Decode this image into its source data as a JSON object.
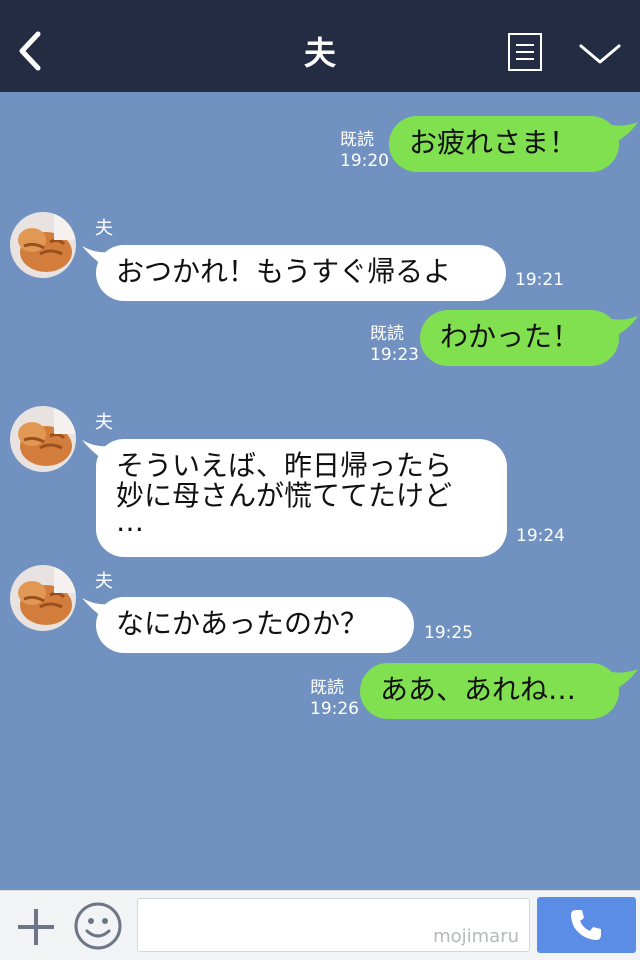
{
  "header": {
    "title": "夫"
  },
  "messages": [
    {
      "from": "me",
      "text": "お疲れさま！",
      "read": "既読",
      "time": "19:20"
    },
    {
      "from": "husband",
      "sender": "夫",
      "text": "おつかれ！もうすぐ帰るよ",
      "time": "19:21"
    },
    {
      "from": "me",
      "text": "わかった！",
      "read": "既読",
      "time": "19:23"
    },
    {
      "from": "husband",
      "sender": "夫",
      "lines": [
        "そういえば、昨日帰ったら",
        "妙に母さんが慌ててたけど",
        "…"
      ],
      "time": "19:24"
    },
    {
      "from": "husband",
      "sender": "夫",
      "text": "なにかあったのか？",
      "time": "19:25"
    },
    {
      "from": "me",
      "text": "ああ、あれね…",
      "read": "既読",
      "time": "19:26"
    }
  ],
  "footer": {
    "watermark": "mojimaru"
  },
  "icons": [
    "back-icon",
    "menu-icon",
    "chevron-down-icon",
    "plus-icon",
    "smiley-icon",
    "phone-icon"
  ],
  "colors": {
    "header": "#232c43",
    "background": "#7192c1",
    "sent_bubble": "#80e050",
    "received_bubble": "#ffffff",
    "call_button": "#5b8ce6"
  }
}
